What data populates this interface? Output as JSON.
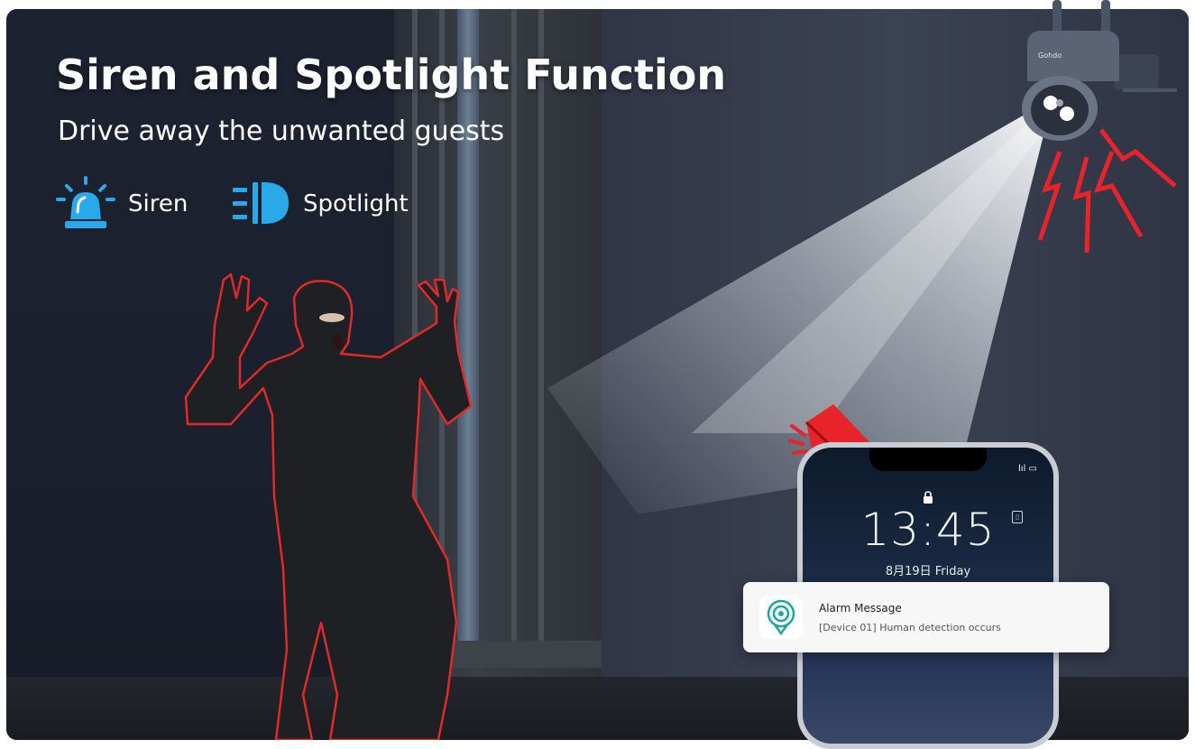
{
  "banner": {
    "title": "Siren and Spotlight Function",
    "subtitle": "Drive away the unwanted guests"
  },
  "features": [
    {
      "label": "Siren",
      "icon": "siren-icon"
    },
    {
      "label": "Spotlight",
      "icon": "spotlight-icon"
    }
  ],
  "phone": {
    "time": "13:45",
    "date": "8月19日 Friday",
    "status": "lıl ▭"
  },
  "notification": {
    "title": "Alarm Message",
    "body": "[Device 01] Human detection occurs",
    "icon": "app-logo-icon"
  },
  "colors": {
    "accent_blue": "#29a8ea",
    "alert_red": "#e8232a",
    "text_white": "#ffffff"
  }
}
